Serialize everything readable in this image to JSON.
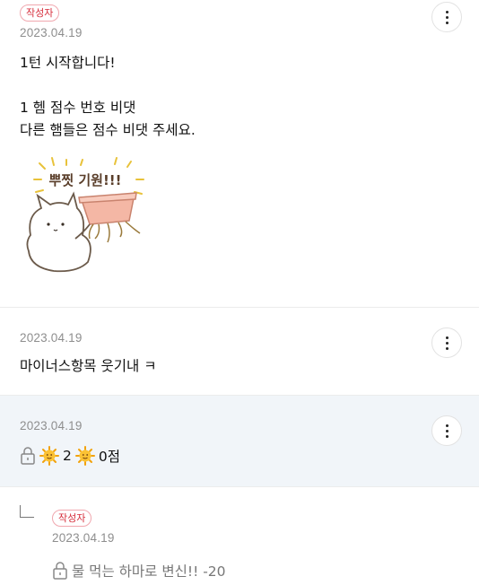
{
  "comments": [
    {
      "badge": "작성자",
      "date": "2023.04.19",
      "text": "1턴 시작합니다!\n\n1 헴 점수 번호 비댓\n다른 햄들은 점수 비댓 주세요.",
      "sticker": {
        "text": "뿌찟 기원!!!"
      }
    },
    {
      "date": "2023.04.19",
      "text": "마이너스항목 웃기내 ㅋ"
    },
    {
      "date": "2023.04.19",
      "text_a": "2",
      "text_b": "0점"
    },
    {
      "badge": "작성자",
      "date": "2023.04.19",
      "text": "물 먹는 하마로 변신!! -20"
    }
  ],
  "colors": {
    "badge_red": "#d62e3c",
    "highlight_bg": "#f1f5f9",
    "date_grey": "#8e8e8e"
  },
  "icons": {
    "more": "more-vertical-icon",
    "lock": "lock-icon",
    "sun": "sun-emoji-icon",
    "reply": "reply-arrow-icon"
  }
}
